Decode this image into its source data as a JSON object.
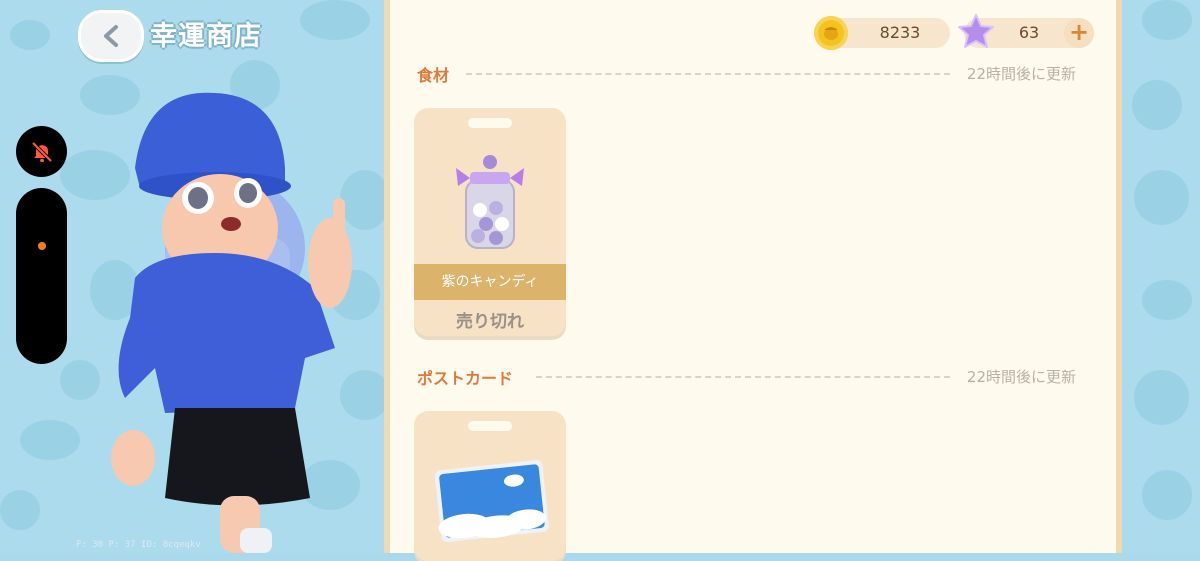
{
  "header": {
    "title": "幸運商店"
  },
  "currency": {
    "coins": "8233",
    "stars": "63",
    "add_label": "+"
  },
  "sections": [
    {
      "title": "食材",
      "refresh": "22時間後に更新",
      "items": [
        {
          "name": "紫のキャンディ",
          "status": "売り切れ"
        }
      ]
    },
    {
      "title": "ポストカード",
      "refresh": "22時間後に更新",
      "items": [
        {
          "name": ""
        }
      ]
    }
  ],
  "debug_text": "F: 30   P: 37   ID: 8cqeqkv",
  "icons": {
    "back": "chevron-left-icon",
    "mute": "bell-off-icon",
    "coin": "acorn-coin-icon",
    "star": "star-icon"
  },
  "colors": {
    "accent": "#e07a3a",
    "panel_bg": "#fefaee",
    "side_bg": "#abdbec",
    "label_gold": "#dbb36a",
    "mute_red": "#ff5a3c"
  }
}
